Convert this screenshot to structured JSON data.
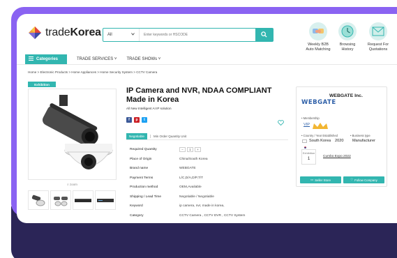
{
  "header": {
    "logo_text_light": "trade",
    "logo_text_bold": "Korea",
    "search_category": "All",
    "search_placeholder": "Enter keywords or HSCODE",
    "icons": [
      {
        "label_line1": "Weekly B2B",
        "label_line2": "Auto Matching",
        "icon": "handshake-icon"
      },
      {
        "label_line1": "Browsing",
        "label_line2": "History",
        "icon": "clock-icon"
      },
      {
        "label_line1": "Request For",
        "label_line2": "Quotations",
        "icon": "envelope-icon"
      }
    ]
  },
  "nav": {
    "categories_label": "Categories",
    "items": [
      "TRADE SERVICES",
      "TRADE SHOWs"
    ]
  },
  "breadcrumb": "Home  >  Electronic Products  >  Home Appliances  >  Home Security System  >  CCTV Camera",
  "product": {
    "badge": "Exhibition",
    "title": "IP Camera and NVR, NDAA COMPLIANT Made in Korea",
    "subtitle": "All New Intelligent AI IP solution",
    "zoom_label": "zoom",
    "tab_active": "Negotiable",
    "tab_other": "Min Order Quantity Unit",
    "specs": [
      {
        "label": "Required Quantity",
        "value": ""
      },
      {
        "label": "Place of Origin",
        "value": "China/South Korea"
      },
      {
        "label": "Brand name",
        "value": "WEBGATE"
      },
      {
        "label": "Payment Terms",
        "value": "L/C,D/A,D/P,T/T"
      },
      {
        "label": "Production method",
        "value": "OEM,Available"
      },
      {
        "label": "Shipping / Lead Time",
        "value": "Negotiable / Negotiable"
      },
      {
        "label": "Keyword",
        "value": "ip camera, nvr, made in korea,"
      },
      {
        "label": "Category",
        "value": "CCTV Camera , CCTV DVR , CCTV System"
      }
    ],
    "quantity": "1"
  },
  "seller": {
    "logo_text": "WEBGATE",
    "name": "WEBGATE Inc.",
    "membership_label": "Membership",
    "membership_value": "VIP",
    "country_label": "Country / Year Established",
    "country": "South Korea",
    "year": "2020",
    "business_label": "Business type",
    "business": "Manufacturer",
    "exhibition_label": "Exhibition",
    "exhibition_count": "1",
    "exhibition_name": "Cumbo Expo 2022",
    "seller_store_btn": "Seller Store",
    "follow_btn": "Follow Company"
  },
  "colors": {
    "accent": "#32b6b0",
    "frame": "#8a63f2",
    "frame_dark": "#2b2557",
    "seller_logo": "#2d5fa8"
  }
}
